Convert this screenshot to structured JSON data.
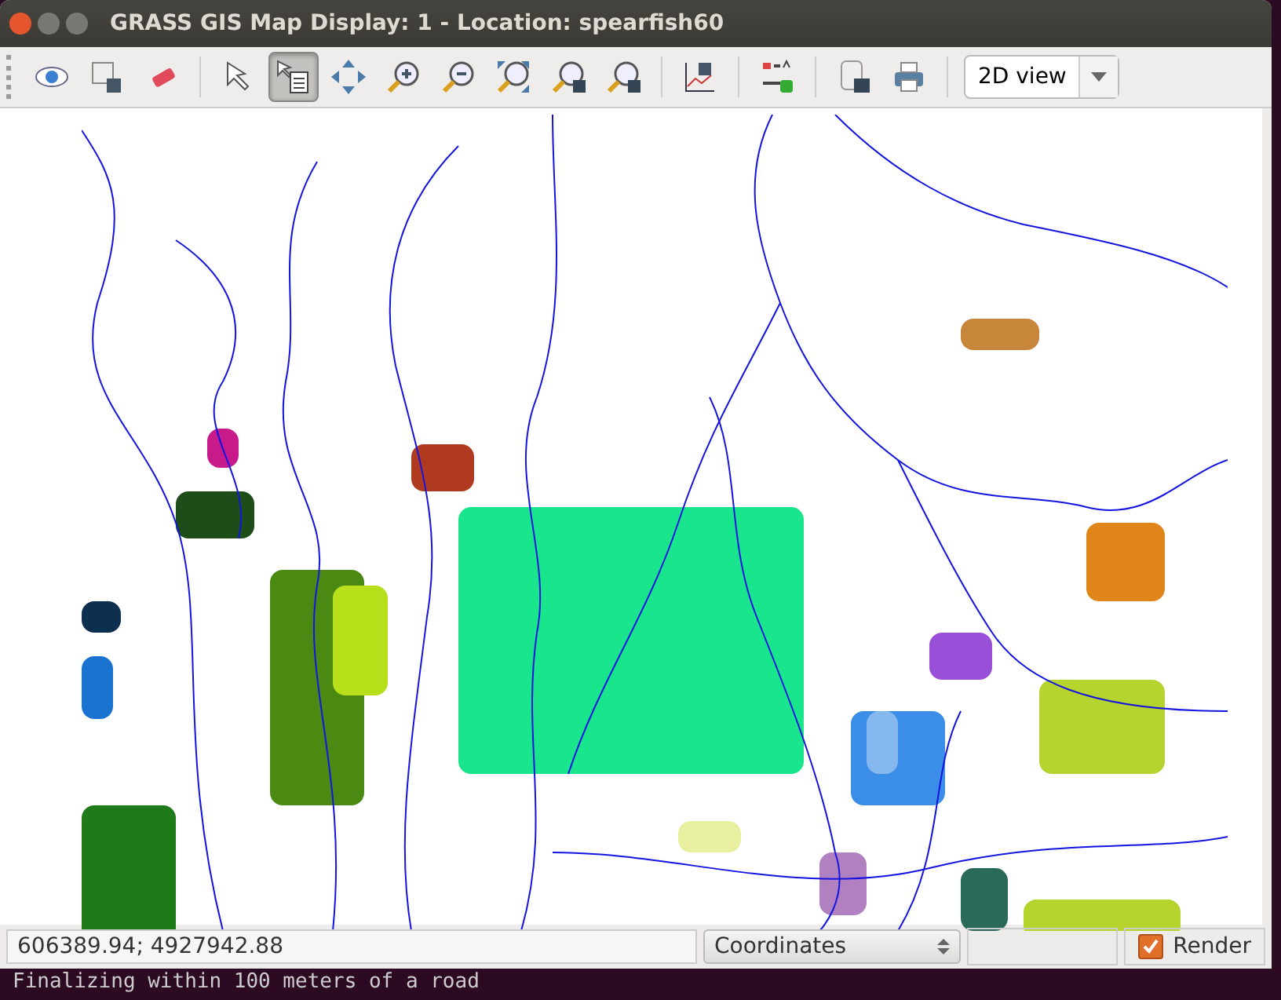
{
  "window": {
    "title": "GRASS GIS Map Display: 1  - Location: spearfish60"
  },
  "toolbar": {
    "tools": [
      {
        "kind": "eye",
        "selected": false
      },
      {
        "kind": "layers",
        "selected": false
      },
      {
        "kind": "eraser",
        "selected": false
      },
      {
        "kind": "sep"
      },
      {
        "kind": "pointer",
        "selected": false
      },
      {
        "kind": "query",
        "selected": true
      },
      {
        "kind": "pan",
        "selected": false
      },
      {
        "kind": "zoomin",
        "selected": false
      },
      {
        "kind": "zoomout",
        "selected": false
      },
      {
        "kind": "zoomextent",
        "selected": false
      },
      {
        "kind": "zoomback",
        "selected": false
      },
      {
        "kind": "zoommenu",
        "selected": false
      },
      {
        "kind": "sep"
      },
      {
        "kind": "analyze",
        "selected": false
      },
      {
        "kind": "sep"
      },
      {
        "kind": "decorate",
        "selected": false
      },
      {
        "kind": "sep"
      },
      {
        "kind": "export",
        "selected": false
      },
      {
        "kind": "print",
        "selected": false
      },
      {
        "kind": "sep"
      }
    ],
    "view_select": {
      "value": "2D view"
    }
  },
  "status_bar": {
    "coordinates": "606389.94; 4927942.88",
    "mode": "Coordinates",
    "render": {
      "label": "Render",
      "checked": true
    }
  },
  "terminal": {
    "line": "Finalizing within 100 meters of a road"
  }
}
